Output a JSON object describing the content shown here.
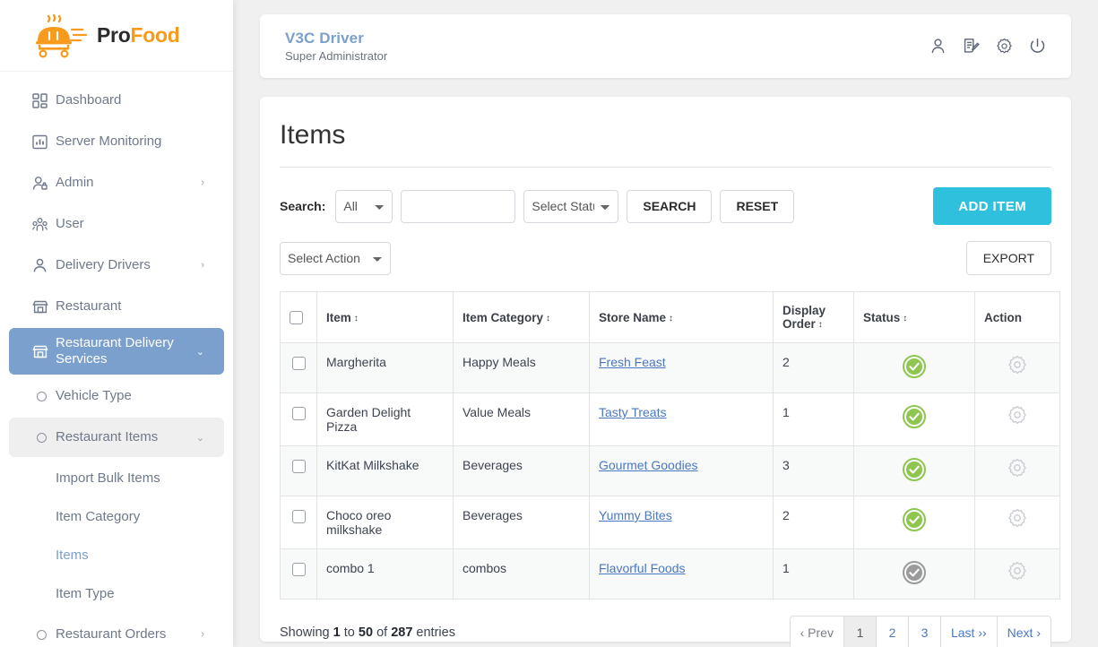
{
  "brand": {
    "name_part1": "Pro",
    "name_part2": "Food",
    "logo_icon": "food-cart-logo",
    "accent_orange": "#f89a1c"
  },
  "sidebar": {
    "items": [
      {
        "label": "Dashboard",
        "icon": "dashboard-grid-icon",
        "caret": "",
        "state": "normal"
      },
      {
        "label": "Server Monitoring",
        "icon": "chart-bar-icon",
        "caret": "",
        "state": "normal"
      },
      {
        "label": "Admin",
        "icon": "user-lock-icon",
        "caret": "›",
        "state": "normal"
      },
      {
        "label": "User",
        "icon": "users-group-icon",
        "caret": "",
        "state": "normal"
      },
      {
        "label": "Delivery Drivers",
        "icon": "user-icon",
        "caret": "›",
        "state": "normal"
      },
      {
        "label": "Restaurant",
        "icon": "store-icon",
        "caret": "",
        "state": "normal"
      },
      {
        "label": "Restaurant Delivery Services",
        "icon": "store-icon",
        "caret": "⌄",
        "state": "active"
      },
      {
        "label": "Vehicle Type",
        "icon": "circle-bullet-icon",
        "caret": "",
        "state": "bullet"
      },
      {
        "label": "Restaurant Items",
        "icon": "circle-bullet-icon",
        "caret": "⌄",
        "state": "bullet-open"
      }
    ],
    "children": [
      {
        "label": "Import Bulk Items",
        "selected": false
      },
      {
        "label": "Item Category",
        "selected": false
      },
      {
        "label": "Items",
        "selected": true
      },
      {
        "label": "Item Type",
        "selected": false
      }
    ],
    "tail_items": [
      {
        "label": "Restaurant Orders",
        "icon": "circle-bullet-icon",
        "caret": "›",
        "state": "bullet"
      }
    ],
    "active_bg": "#7ba0ce"
  },
  "topbar": {
    "title": "V3C Driver",
    "subtitle": "Super Administrator",
    "title_color": "#7ba0ce",
    "icons": [
      {
        "name": "profile-user-icon"
      },
      {
        "name": "document-edit-icon"
      },
      {
        "name": "settings-gear-icon"
      },
      {
        "name": "power-logout-icon"
      }
    ]
  },
  "page": {
    "title": "Items"
  },
  "toolbar": {
    "search_label": "Search:",
    "search_scope_value": "All",
    "search_scope_options": [
      "All"
    ],
    "search_text_value": "",
    "search_text_placeholder": "",
    "status_value": "Select Status",
    "status_options": [
      "Select Status"
    ],
    "search_button": "SEARCH",
    "reset_button": "RESET",
    "add_item_button": "ADD ITEM",
    "add_item_color": "#2ec0dd",
    "select_action_value": "Select Action",
    "select_action_options": [
      "Select Action"
    ],
    "export_button": "EXPORT"
  },
  "table": {
    "columns": [
      {
        "key": "checkbox",
        "label": "",
        "sortable": false
      },
      {
        "key": "item",
        "label": "Item",
        "sortable": true
      },
      {
        "key": "category",
        "label": "Item Category",
        "sortable": true
      },
      {
        "key": "store",
        "label": "Store Name",
        "sortable": true
      },
      {
        "key": "order",
        "label": "Display Order",
        "sortable": true
      },
      {
        "key": "status",
        "label": "Status",
        "sortable": true
      },
      {
        "key": "action",
        "label": "Action",
        "sortable": false
      }
    ],
    "sort_glyph": "↕",
    "rows": [
      {
        "item": "Margherita",
        "category": "Happy Meals",
        "store": "Fresh Feast",
        "order": "2",
        "status": "active",
        "action_icon": "gear-icon"
      },
      {
        "item": "Garden Delight Pizza",
        "category": "Value Meals",
        "store": "Tasty Treats",
        "order": "1",
        "status": "active",
        "action_icon": "gear-icon"
      },
      {
        "item": "KitKat Milkshake",
        "category": "Beverages",
        "store": "Gourmet Goodies",
        "order": "3",
        "status": "active",
        "action_icon": "gear-icon"
      },
      {
        "item": "Choco oreo milkshake",
        "category": "Beverages",
        "store": "Yummy Bites",
        "order": "2",
        "status": "active",
        "action_icon": "gear-icon"
      },
      {
        "item": "combo 1",
        "category": "combos",
        "store": "Flavorful Foods",
        "order": "1",
        "status": "inactive",
        "action_icon": "gear-icon"
      }
    ],
    "status_colors": {
      "active": "#8ec64f",
      "inactive": "#9b9b9b"
    }
  },
  "footer": {
    "showing_prefix": "Showing",
    "showing_from": "1",
    "showing_mid": "to",
    "showing_to": "50",
    "showing_of": "of",
    "showing_total": "287",
    "showing_suffix": "entries",
    "pagination": [
      {
        "label": "‹ Prev",
        "state": "disabled"
      },
      {
        "label": "1",
        "state": "current"
      },
      {
        "label": "2",
        "state": "link"
      },
      {
        "label": "3",
        "state": "link"
      },
      {
        "label": "Last ››",
        "state": "link"
      },
      {
        "label": "Next ›",
        "state": "link"
      }
    ]
  }
}
